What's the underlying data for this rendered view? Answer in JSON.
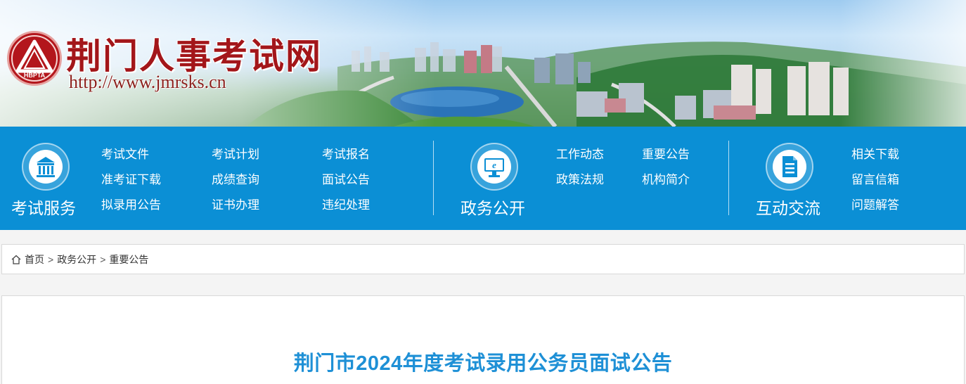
{
  "header": {
    "site_title": "荆门人事考试网",
    "site_url": "http://www.jmrsks.cn",
    "logo_text": "HBPTA"
  },
  "nav": {
    "groups": [
      {
        "title": "考试服务",
        "icon": "building-icon",
        "links": [
          "考试文件",
          "考试计划",
          "考试报名",
          "准考证下载",
          "成绩查询",
          "面试公告",
          "拟录用公告",
          "证书办理",
          "违纪处理"
        ]
      },
      {
        "title": "政务公开",
        "icon": "monitor-e-icon",
        "links": [
          "工作动态",
          "重要公告",
          "政策法规",
          "机构简介"
        ]
      },
      {
        "title": "互动交流",
        "icon": "document-icon",
        "links": [
          "相关下载",
          "留言信箱",
          "问题解答"
        ]
      }
    ]
  },
  "breadcrumb": {
    "items": [
      "首页",
      "政务公开",
      "重要公告"
    ],
    "separator": ">"
  },
  "article": {
    "title": "荆门市2024年度考试录用公务员面试公告"
  },
  "colors": {
    "nav_bg": "#0b8fd5",
    "title_red": "#a3161a",
    "article_title": "#1e90d6"
  }
}
